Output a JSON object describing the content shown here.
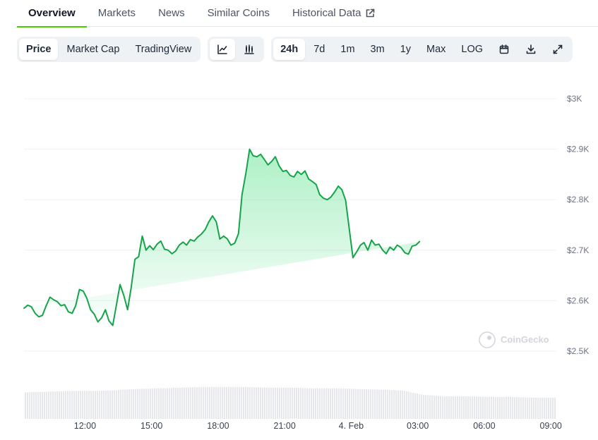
{
  "nav": {
    "tabs": [
      {
        "label": "Overview",
        "active": true
      },
      {
        "label": "Markets",
        "active": false
      },
      {
        "label": "News",
        "active": false
      },
      {
        "label": "Similar Coins",
        "active": false
      },
      {
        "label": "Historical Data",
        "active": false,
        "icon": "external-link-icon"
      }
    ]
  },
  "toolbar": {
    "type_tabs": [
      {
        "label": "Price",
        "active": true
      },
      {
        "label": "Market Cap",
        "active": false
      },
      {
        "label": "TradingView",
        "active": false
      }
    ],
    "chart_style_icons": [
      "line-chart-icon",
      "candlestick-icon"
    ],
    "ranges": [
      {
        "label": "24h",
        "active": true
      },
      {
        "label": "7d",
        "active": false
      },
      {
        "label": "1m",
        "active": false
      },
      {
        "label": "3m",
        "active": false
      },
      {
        "label": "1y",
        "active": false
      },
      {
        "label": "Max",
        "active": false
      },
      {
        "label": "LOG",
        "active": false
      }
    ],
    "action_icons": [
      "calendar-icon",
      "download-icon",
      "expand-icon"
    ]
  },
  "watermark": "CoinGecko",
  "chart_data": {
    "type": "area",
    "title": "",
    "xlabel": "",
    "ylabel": "",
    "ylim": [
      2480,
      3000
    ],
    "yticks": [
      3000,
      2900,
      2800,
      2700,
      2600,
      2500
    ],
    "ytick_labels": [
      "$3K",
      "$2.9K",
      "$2.8K",
      "$2.7K",
      "$2.6K",
      "$2.5K"
    ],
    "xlim": [
      9.25,
      33.25
    ],
    "xticks": [
      12,
      15,
      18,
      21,
      24,
      27,
      30,
      33
    ],
    "xtick_labels": [
      "12:00",
      "15:00",
      "18:00",
      "21:00",
      "4. Feb",
      "03:00",
      "06:00",
      "09:00"
    ],
    "grid": true,
    "colors": {
      "line": "#16a34a",
      "fill_top": "#4ade80",
      "volume": "#e5e7eb",
      "grid": "#eef0f3",
      "tick": "#6b7280"
    },
    "price": {
      "name": "",
      "x": [
        9.25,
        9.42,
        9.58,
        9.75,
        9.92,
        10.08,
        10.25,
        10.42,
        10.58,
        10.75,
        10.92,
        11.08,
        11.25,
        11.42,
        11.58,
        11.75,
        11.92,
        12.08,
        12.25,
        12.42,
        12.58,
        12.75,
        12.92,
        13.08,
        13.25,
        13.42,
        13.58,
        13.75,
        13.92,
        14.08,
        14.25,
        14.42,
        14.58,
        14.75,
        14.92,
        15.08,
        15.25,
        15.42,
        15.58,
        15.75,
        15.92,
        16.08,
        16.25,
        16.42,
        16.58,
        16.75,
        16.92,
        17.08,
        17.25,
        17.42,
        17.58,
        17.75,
        17.92,
        18.08,
        18.25,
        18.42,
        18.58,
        18.75,
        18.92,
        19.08,
        19.25,
        19.42,
        19.58,
        19.75,
        19.92,
        20.08,
        20.25,
        20.42,
        20.58,
        20.75,
        20.92,
        21.08,
        21.25,
        21.42,
        21.58,
        21.75,
        21.92,
        22.08,
        22.25,
        22.42,
        22.58,
        22.75,
        22.92,
        23.08,
        23.25,
        23.42,
        23.58,
        23.75,
        23.92,
        24.08,
        24.25,
        24.42,
        24.58,
        24.75,
        24.92,
        25.08,
        25.25,
        25.42,
        25.58,
        25.75,
        25.92,
        26.08,
        26.25,
        26.42,
        26.58,
        26.75,
        26.92,
        27.08,
        27.25,
        27.42,
        27.58,
        27.75,
        27.92,
        28.08,
        28.25,
        28.42,
        28.58,
        28.75,
        28.92,
        29.08,
        29.25,
        29.42,
        29.58,
        29.75,
        29.92,
        30.08,
        30.25,
        30.42,
        30.58,
        30.75,
        30.92,
        31.08,
        31.25,
        31.42,
        31.58,
        31.75,
        31.92,
        32.08,
        32.25,
        32.42,
        32.58,
        32.75,
        32.92,
        33.08,
        33.25
      ],
      "values": [
        2585,
        2591,
        2588,
        2575,
        2568,
        2571,
        2590,
        2607,
        2602,
        2598,
        2590,
        2592,
        2578,
        2575,
        2590,
        2622,
        2619,
        2605,
        2582,
        2573,
        2558,
        2566,
        2582,
        2560,
        2551,
        2592,
        2632,
        2610,
        2582,
        2625,
        2682,
        2687,
        2728,
        2700,
        2709,
        2701,
        2712,
        2718,
        2702,
        2700,
        2693,
        2698,
        2710,
        2716,
        2710,
        2721,
        2718,
        2726,
        2732,
        2741,
        2756,
        2768,
        2756,
        2722,
        2728,
        2722,
        2710,
        2714,
        2733,
        2810,
        2852,
        2900,
        2887,
        2885,
        2890,
        2880,
        2869,
        2876,
        2885,
        2867,
        2856,
        2858,
        2848,
        2845,
        2856,
        2850,
        2857,
        2841,
        2836,
        2830,
        2810,
        2803,
        2800,
        2805,
        2815,
        2827,
        2820,
        2799,
        2740,
        2685,
        2697,
        2710,
        2715,
        2700,
        2720,
        2710,
        2712,
        2700,
        2693,
        2706,
        2700,
        2710,
        2705,
        2695,
        2692,
        2708,
        2710,
        2717
      ],
      "note": ""
    },
    "volume": {
      "name": "",
      "x": [
        9.25,
        10.25,
        11.25,
        12.25,
        13.25,
        14.25,
        15.25,
        16.25,
        17.25,
        18.25,
        19.25,
        20.25,
        21.25,
        22.25,
        23.25,
        24.25,
        25.25,
        26.25,
        27.25,
        28.25,
        29.25,
        30.25,
        31.25,
        32.25,
        33.25
      ],
      "values": [
        40,
        41,
        42,
        42,
        43,
        45,
        46,
        47,
        48,
        48,
        48,
        47,
        47,
        46,
        46,
        45,
        44,
        43,
        36,
        34,
        34,
        33,
        33,
        32,
        32
      ]
    }
  }
}
